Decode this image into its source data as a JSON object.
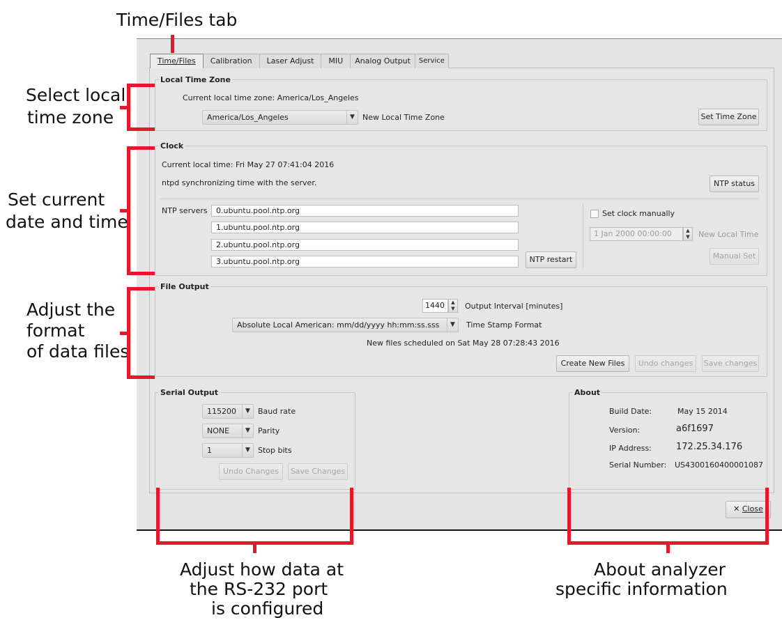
{
  "callouts": {
    "time_files_tab": "Time/Files tab",
    "select_tz_line1": "Select local",
    "select_tz_line2": "time zone",
    "set_clock_line1": "Set current",
    "set_clock_line2": "date and time",
    "file_fmt_line1": "Adjust the",
    "file_fmt_line2": "format",
    "file_fmt_line3": "of data files",
    "serial_line1": "Adjust how data at",
    "serial_line2": "the RS-232 port",
    "serial_line3": "is configured",
    "about_line1": "About analyzer",
    "about_line2": "specific information"
  },
  "tabs": [
    "Time/Files",
    "Calibration",
    "Laser Adjust",
    "MIU",
    "Analog Output",
    "Service"
  ],
  "timezone": {
    "title": "Local Time Zone",
    "current_label": "Current local time zone: America/Los_Angeles",
    "selected": "America/Los_Angeles",
    "new_label": "New Local Time Zone",
    "set_button": "Set Time Zone"
  },
  "clock": {
    "title": "Clock",
    "current_time": "Current local time: Fri May 27 07:41:04 2016",
    "status": "ntpd synchronizing time with the server.",
    "ntp_status_button": "NTP status",
    "ntp_servers_label": "NTP servers",
    "servers": [
      "0.ubuntu.pool.ntp.org",
      "1.ubuntu.pool.ntp.org",
      "2.ubuntu.pool.ntp.org",
      "3.ubuntu.pool.ntp.org"
    ],
    "ntp_restart_button": "NTP restart",
    "manual_checkbox_label": "Set clock manually",
    "manual_value": "1 Jan 2000 00:00:00",
    "new_local_time_label": "New Local Time",
    "manual_set_button": "Manual Set"
  },
  "file_output": {
    "title": "File Output",
    "interval_value": "1440",
    "interval_label": "Output Interval [minutes]",
    "format_selected": "Absolute Local American: mm/dd/yyyy hh:mm:ss.sss",
    "format_label": "Time Stamp Format",
    "scheduled": "New files scheduled on Sat May 28 07:28:43 2016",
    "create_button": "Create New Files",
    "undo_button": "Undo changes",
    "save_button": "Save changes"
  },
  "serial": {
    "title": "Serial Output",
    "baud_value": "115200",
    "baud_label": "Baud rate",
    "parity_value": "NONE",
    "parity_label": "Parity",
    "stop_value": "1",
    "stop_label": "Stop bits",
    "undo_button": "Undo Changes",
    "save_button": "Save Changes"
  },
  "about": {
    "title": "About",
    "build_label": "Build Date:",
    "build_value": "May 15 2014",
    "version_label": "Version:",
    "version_value": "a6f1697",
    "ip_label": "IP Address:",
    "ip_value": "172.25.34.176",
    "serial_label": "Serial Number:",
    "serial_value": "US4300160400001087"
  },
  "close_button": "Close",
  "close_glyph": "✕"
}
